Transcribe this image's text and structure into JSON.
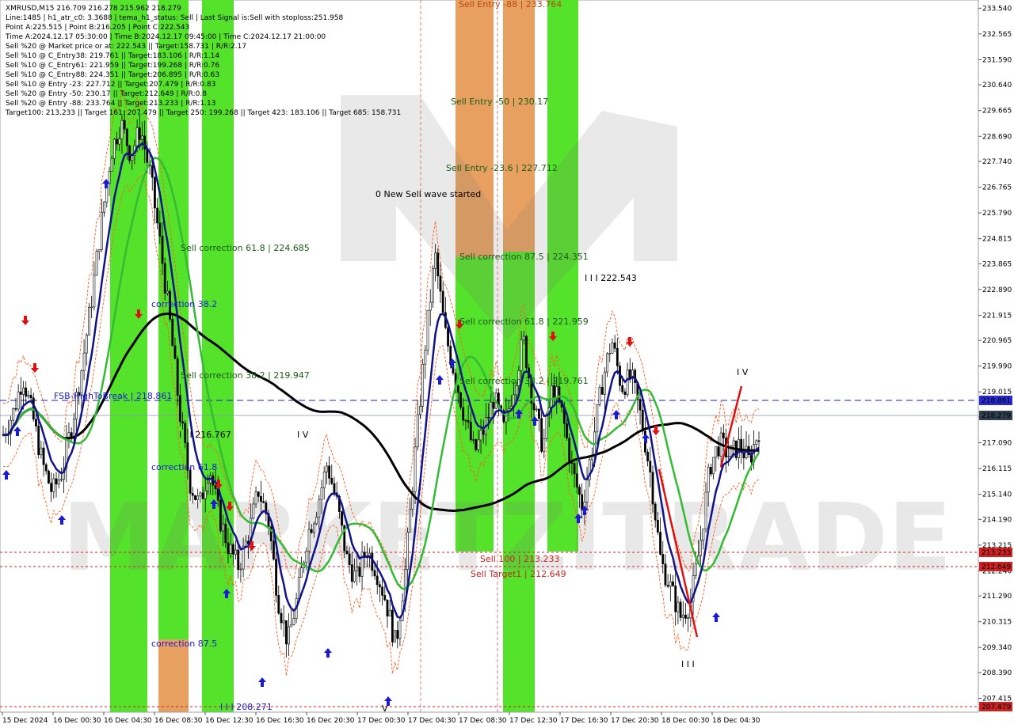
{
  "info_panel": [
    "XMRUSD,M15  216.709 216.278 215.962 218.279",
    "Line:1485 | h1_atr_c0: 3.3688 | tema_h1_status: Sell | Last Signal is:Sell with stoploss:251.958",
    "Point A:225.515 | Point B:216.205 | Point C:222.543",
    "Time A:2024.12.17 05:30:00 | Time B:2024.12.17 09:45:00 | Time C:2024.12.17 21:00:00",
    "Sell %20 @ Market price or at: 222.543 || Target:158.731 | R/R:2.17",
    "Sell %10 @ C_Entry38: 219.761 || Target:183.106 | R/R:1.14",
    "Sell %10 @ C_Entry61: 221.959 || Target:199.268 | R/R:0.76",
    "Sell %10 @ C_Entry88: 224.351 || Target:206.895 | R/R:0.63",
    "Sell %10 @ Entry -23: 227.712 || Target:207.479 | R/R:0.83",
    "Sell %20 @ Entry -50: 230.17 || Target:212.649 | R/R:0.8",
    "Sell %20 @ Entry -88: 233.764 || Target:213.233 | R/R:1.13",
    "Target100: 213.233 || Target 161: 207.479 || Target 250: 199.268 || Target 423: 183.106 || Target 685: 158.731"
  ],
  "overlay_title": "0 New Sell wave started",
  "watermark": "MARKETZITRADE",
  "chart_labels": {
    "new_sell_wave": "0 New Sell wave started",
    "sell_entry_88": "Sell Entry -88 | 233.764",
    "sell_entry_50": "Sell Entry -50 | 230.17",
    "sell_entry_23": "Sell Entry -23.6 | 227.712",
    "sell_corr_875": "Sell correction 87.5 | 224.351",
    "sell_corr_618_right": "Sell correction 61.8 | 221.959",
    "sell_corr_382_right": "Sell correction 38.2 | 219.761",
    "sell_corr_618_left": "Sell correction 61.8 | 224.685",
    "sell_corr_382_left": "Sell correction 38.2 | 219.947",
    "correction_382": "correction 38.2",
    "correction_618": "correction 61.8",
    "correction_875": "correction 87.5",
    "fsb": "FSB-HighToBreak | 218.861",
    "sell_100": "Sell 100 | 213.233",
    "sell_target1": "Sell Target1 | 212.649",
    "wave_iii_top": "I I I 222.543",
    "wave_iii_mid": "I I I 216.767",
    "wave_iii_low": "I I I 208.271",
    "wave_iv_mid": "I V",
    "wave_iv_right": "I V",
    "wave_iii_right": "I I I",
    "wave_v": "V"
  },
  "price_tags": {
    "current": "218.279",
    "fsb": "218.861",
    "sell100": "213.233",
    "target1": "212.649",
    "bottom": "207.479"
  },
  "colors": {
    "green_zone": "#55e22a",
    "orange_zone": "#e8a060",
    "red_line": "#cc0000",
    "blue_line": "#1b1bd0",
    "navy_ma": "#12128a",
    "green_ma": "#33bb33",
    "black_ma": "#000000",
    "current_tag": "#2f3f4f",
    "red_tag": "#cc2222",
    "blue_tag": "#2a2acc"
  },
  "chart_data": {
    "type": "candlestick",
    "symbol": "XMRUSD",
    "timeframe": "M15",
    "ohlc_header": [
      216.709,
      216.278,
      215.962,
      218.279
    ],
    "y_ticks": [
      "233.540",
      "232.565",
      "231.590",
      "230.640",
      "229.665",
      "228.690",
      "227.740",
      "226.765",
      "225.790",
      "224.815",
      "223.865",
      "222.890",
      "221.915",
      "220.965",
      "219.990",
      "219.015",
      "218.065",
      "217.090",
      "216.115",
      "215.140",
      "214.190",
      "213.215",
      "212.240",
      "211.290",
      "210.315",
      "209.340",
      "208.390",
      "207.415"
    ],
    "x_ticks": [
      "15 Dec 2024",
      "16 Dec 00:30",
      "16 Dec 04:30",
      "16 Dec 08:30",
      "16 Dec 12:30",
      "16 Dec 16:30",
      "16 Dec 20:30",
      "17 Dec 00:30",
      "17 Dec 04:30",
      "17 Dec 08:30",
      "17 Dec 12:30",
      "17 Dec 16:30",
      "17 Dec 20:30",
      "18 Dec 00:30",
      "18 Dec 04:30"
    ],
    "ylim": [
      207.1,
      233.7
    ],
    "levels": [
      {
        "name": "FSB-HighToBreak",
        "value": 218.861,
        "style": "dashed-blue"
      },
      {
        "name": "current",
        "value": 218.279,
        "style": "solid-gray"
      },
      {
        "name": "Sell 100",
        "value": 213.233,
        "style": "dotted-red"
      },
      {
        "name": "Sell Target1",
        "value": 212.649,
        "style": "dotted-red"
      },
      {
        "name": "Target 161",
        "value": 207.479,
        "style": "dotted-red"
      }
    ],
    "close_series": [
      217.4,
      218.2,
      219.6,
      218.1,
      216.3,
      215.2,
      216.0,
      217.8,
      219.9,
      222.5,
      225.4,
      228.1,
      229.2,
      228.0,
      229.0,
      227.2,
      224.6,
      221.6,
      218.2,
      215.6,
      214.7,
      216.2,
      214.3,
      213.1,
      212.4,
      213.6,
      215.3,
      214.2,
      211.2,
      209.5,
      211.3,
      213.6,
      214.7,
      216.3,
      214.8,
      212.7,
      211.9,
      213.1,
      212.3,
      211.1,
      209.4,
      212.4,
      216.8,
      220.8,
      224.2,
      221.3,
      219.7,
      218.1,
      216.7,
      217.6,
      218.8,
      217.6,
      219.2,
      221.0,
      218.6,
      216.9,
      219.3,
      218.1,
      216.0,
      214.7,
      216.9,
      219.3,
      221.0,
      219.2,
      219.6,
      218.0,
      215.8,
      212.6,
      211.6,
      210.5,
      211.0,
      213.2,
      216.2,
      217.1,
      216.6,
      217.0,
      216.4,
      217.6
    ]
  }
}
